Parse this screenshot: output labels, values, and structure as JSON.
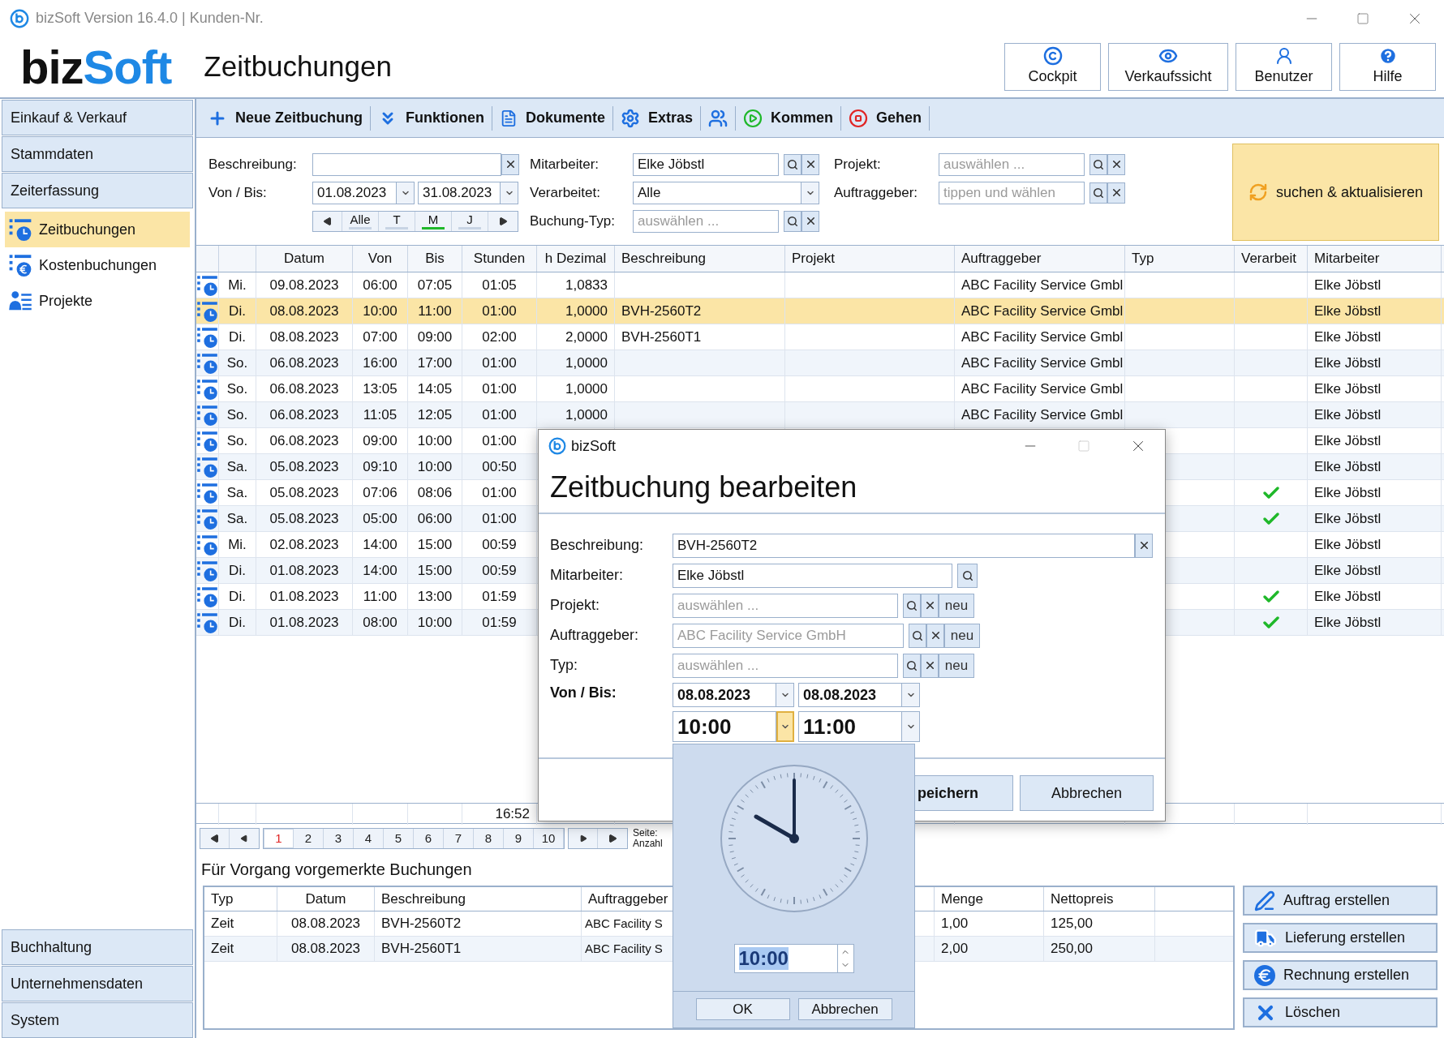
{
  "window": {
    "title": "bizSoft Version 16.4.0 | Kunden-Nr."
  },
  "logo": [
    "biz",
    "Soft"
  ],
  "page_title": "Zeitbuchungen",
  "header_buttons": [
    {
      "label": "Cockpit",
      "kind": "cockpit"
    },
    {
      "label": "Verkaufssicht",
      "kind": "view"
    },
    {
      "label": "Benutzer",
      "kind": "user"
    },
    {
      "label": "Hilfe",
      "kind": "help"
    }
  ],
  "sidebar": {
    "sections": [
      {
        "label": "Einkauf & Verkauf"
      },
      {
        "label": "Stammdaten"
      },
      {
        "label": "Zeiterfassung",
        "items": [
          {
            "label": "Zeitbuchungen",
            "selected": true,
            "kind": "time"
          },
          {
            "label": "Kostenbuchungen",
            "selected": false,
            "kind": "cost"
          },
          {
            "label": "Projekte",
            "selected": false,
            "kind": "projects"
          }
        ]
      }
    ],
    "bottom_sections": [
      "Buchhaltung",
      "Unternehmensdaten",
      "System"
    ]
  },
  "toolbar": [
    {
      "label": "Neue Zeitbuchung",
      "kind": "add"
    },
    {
      "label": "Funktionen",
      "kind": "functions"
    },
    {
      "label": "Dokumente",
      "kind": "documents"
    },
    {
      "label": "Extras",
      "kind": "extras"
    },
    {
      "kind": "people"
    },
    {
      "label": "Kommen",
      "kind": "come"
    },
    {
      "label": "Gehen",
      "kind": "go"
    }
  ],
  "filters": {
    "description": {
      "label": "Beschreibung:"
    },
    "period": {
      "label": "Von / Bis:",
      "from": "01.08.2023",
      "to": "31.08.2023",
      "steps": [
        {
          "label": "Alle",
          "selected": false
        },
        {
          "label": "T",
          "selected": false
        },
        {
          "label": "M",
          "selected": true
        },
        {
          "label": "J",
          "selected": false
        }
      ]
    },
    "employee": {
      "label": "Mitarbeiter:",
      "value": "Elke Jöbstl"
    },
    "processed": {
      "label": "Verarbeitet:",
      "value": "Alle"
    },
    "booking_type": {
      "label": "Buchung-Typ:",
      "placeholder": "auswählen ..."
    },
    "project": {
      "label": "Projekt:",
      "placeholder": "auswählen ..."
    },
    "client": {
      "label": "Auftraggeber:",
      "placeholder": "tippen und wählen"
    },
    "search_button": "suchen & aktualisieren"
  },
  "table": {
    "columns": [
      "Datum",
      "Von",
      "Bis",
      "Stunden",
      "h Dezimal",
      "Beschreibung",
      "Projekt",
      "Auftraggeber",
      "Typ",
      "Verarbeit",
      "Mitarbeiter"
    ],
    "rows": [
      {
        "day": "Mi.",
        "date": "09.08.2023",
        "from": "06:00",
        "to": "07:05",
        "hours": "01:05",
        "decimal": "1,0833",
        "client": "ABC Facility Service Gmbl",
        "processed": false,
        "employee": "Elke Jöbstl",
        "selected": false
      },
      {
        "day": "Di.",
        "date": "08.08.2023",
        "from": "10:00",
        "to": "11:00",
        "hours": "01:00",
        "decimal": "1,0000",
        "description": "BVH-2560T2",
        "client": "ABC Facility Service Gmbl",
        "processed": false,
        "employee": "Elke Jöbstl",
        "selected": true
      },
      {
        "day": "Di.",
        "date": "08.08.2023",
        "from": "07:00",
        "to": "09:00",
        "hours": "02:00",
        "decimal": "2,0000",
        "description": "BVH-2560T1",
        "client": "ABC Facility Service Gmbl",
        "processed": false,
        "employee": "Elke Jöbstl",
        "selected": false
      },
      {
        "day": "So.",
        "date": "06.08.2023",
        "from": "16:00",
        "to": "17:00",
        "hours": "01:00",
        "decimal": "1,0000",
        "client": "ABC Facility Service Gmbl",
        "processed": false,
        "employee": "Elke Jöbstl",
        "selected": false
      },
      {
        "day": "So.",
        "date": "06.08.2023",
        "from": "13:05",
        "to": "14:05",
        "hours": "01:00",
        "decimal": "1,0000",
        "client": "ABC Facility Service Gmbl",
        "processed": false,
        "employee": "Elke Jöbstl",
        "selected": false
      },
      {
        "day": "So.",
        "date": "06.08.2023",
        "from": "11:05",
        "to": "12:05",
        "hours": "01:00",
        "decimal": "1,0000",
        "client": "ABC Facility Service Gmbl",
        "processed": false,
        "employee": "Elke Jöbstl",
        "selected": false
      },
      {
        "day": "So.",
        "date": "06.08.2023",
        "from": "09:00",
        "to": "10:00",
        "hours": "01:00",
        "processed": false,
        "employee": "Elke Jöbstl",
        "selected": false
      },
      {
        "day": "Sa.",
        "date": "05.08.2023",
        "from": "09:10",
        "to": "10:00",
        "hours": "00:50",
        "processed": false,
        "employee": "Elke Jöbstl",
        "selected": false
      },
      {
        "day": "Sa.",
        "date": "05.08.2023",
        "from": "07:06",
        "to": "08:06",
        "hours": "01:00",
        "processed": true,
        "employee": "Elke Jöbstl",
        "selected": false
      },
      {
        "day": "Sa.",
        "date": "05.08.2023",
        "from": "05:00",
        "to": "06:00",
        "hours": "01:00",
        "processed": true,
        "employee": "Elke Jöbstl",
        "selected": false
      },
      {
        "day": "Mi.",
        "date": "02.08.2023",
        "from": "14:00",
        "to": "15:00",
        "hours": "00:59",
        "processed": false,
        "employee": "Elke Jöbstl",
        "selected": false
      },
      {
        "day": "Di.",
        "date": "01.08.2023",
        "from": "14:00",
        "to": "15:00",
        "hours": "00:59",
        "processed": false,
        "employee": "Elke Jöbstl",
        "selected": false
      },
      {
        "day": "Di.",
        "date": "01.08.2023",
        "from": "11:00",
        "to": "13:00",
        "hours": "01:59",
        "processed": true,
        "employee": "Elke Jöbstl",
        "selected": false
      },
      {
        "day": "Di.",
        "date": "01.08.2023",
        "from": "08:00",
        "to": "10:00",
        "hours": "01:59",
        "processed": true,
        "employee": "Elke Jöbstl",
        "selected": false
      }
    ],
    "total_hours": "16:52"
  },
  "pager": {
    "pages": [
      {
        "label": "1",
        "selected": true
      },
      {
        "label": "2",
        "selected": false
      },
      {
        "label": "3",
        "selected": false
      },
      {
        "label": "4",
        "selected": false
      },
      {
        "label": "5",
        "selected": false
      },
      {
        "label": "6",
        "selected": false
      },
      {
        "label": "7",
        "selected": false
      },
      {
        "label": "8",
        "selected": false
      },
      {
        "label": "9",
        "selected": false
      },
      {
        "label": "10",
        "selected": false
      }
    ],
    "info": [
      "Seite:",
      "Anzahl"
    ]
  },
  "reserved": {
    "title": "Für Vorgang vorgemerkte Buchungen",
    "columns": [
      "Typ",
      "Datum",
      "Beschreibung",
      "Auftraggeber",
      "Menge",
      "Nettopreis"
    ],
    "rows": [
      {
        "type": "Zeit",
        "date": "08.08.2023",
        "description": "BVH-2560T2",
        "client": "ABC Facility S",
        "quantity": "1,00",
        "net_price": "125,00"
      },
      {
        "type": "Zeit",
        "date": "08.08.2023",
        "description": "BVH-2560T1",
        "client": "ABC Facility S",
        "quantity": "2,00",
        "net_price": "250,00"
      }
    ]
  },
  "actions": [
    {
      "label": "Auftrag erstellen",
      "kind": "order"
    },
    {
      "label": "Lieferung erstellen",
      "kind": "delivery"
    },
    {
      "label": "Rechnung erstellen",
      "kind": "invoice"
    },
    {
      "label": "Löschen",
      "kind": "delete"
    }
  ],
  "dialog": {
    "app": "bizSoft",
    "title": "Zeitbuchung bearbeiten",
    "fields": [
      {
        "label": "Beschreibung:",
        "value": "BVH-2560T2",
        "kind": "clear"
      },
      {
        "label": "Mitarbeiter:",
        "value": "Elke Jöbstl",
        "kind": "search"
      },
      {
        "label": "Projekt:",
        "placeholder": "auswählen ...",
        "kind": "lookup",
        "new_label": "neu"
      },
      {
        "label": "Auftraggeber:",
        "placeholder": "ABC Facility Service GmbH",
        "kind": "lookup",
        "new_label": "neu"
      },
      {
        "label": "Typ:",
        "placeholder": "auswählen ...",
        "kind": "lookup",
        "new_label": "neu"
      }
    ],
    "range": {
      "label": "Von / Bis:",
      "date_from": "08.08.2023",
      "date_to": "08.08.2023",
      "time_from": "10:00",
      "time_to": "11:00"
    },
    "buttons": [
      "peichern",
      "Abbrechen"
    ]
  },
  "time_picker": {
    "value": "10:00",
    "buttons": [
      "OK",
      "Abbrechen"
    ]
  }
}
